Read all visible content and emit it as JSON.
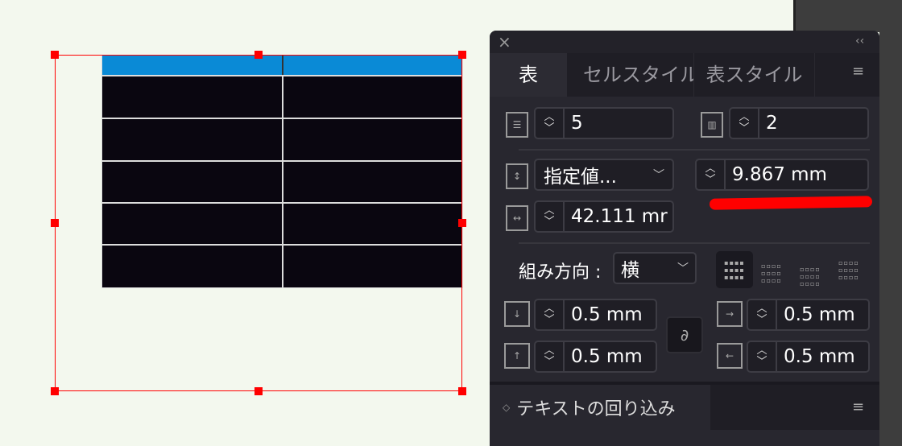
{
  "panel": {
    "close_icon": "×",
    "collapse_icon": "‹‹",
    "tabs": [
      {
        "label": "表"
      },
      {
        "label": "セルスタイル"
      },
      {
        "label": "表スタイル"
      }
    ],
    "rows_value": "5",
    "columns_value": "2",
    "row_height_mode": "指定値...",
    "row_height_value": "9.867 mm",
    "column_width_value": "42.111 mr",
    "direction_label": "組み方向 :",
    "direction_value": "横",
    "inset_top": "0.5 mm",
    "inset_bottom": "0.5 mm",
    "inset_left": "0.5 mm",
    "inset_right": "0.5 mm",
    "text_wrap_label": "テキストの回り込み"
  },
  "colors": {
    "header": "#0a8ad6",
    "selection": "#ff0000",
    "annotation": "#ff0000"
  }
}
